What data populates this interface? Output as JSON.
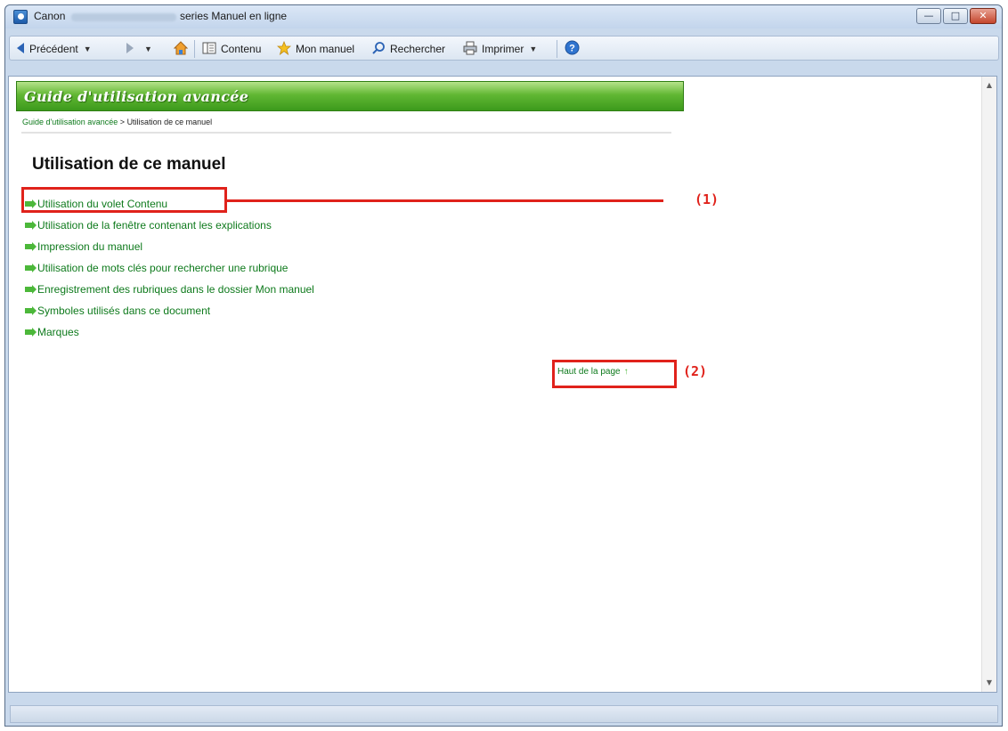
{
  "window": {
    "title_prefix": "Canon",
    "title_suffix": "series Manuel en ligne"
  },
  "titlebar_controls": {
    "minimize_icon": "minimize-icon",
    "maximize_icon": "maximize-icon",
    "close_icon": "close-icon"
  },
  "toolbar": {
    "back_label": "Précédent",
    "contents_label": "Contenu",
    "my_manual_label": "Mon manuel",
    "search_label": "Rechercher",
    "print_label": "Imprimer"
  },
  "page": {
    "banner_title": "Guide d'utilisation avancée",
    "breadcrumb_link": "Guide d'utilisation avancée",
    "breadcrumb_separator": " > ",
    "breadcrumb_current": "Utilisation de ce manuel",
    "title": "Utilisation de ce manuel",
    "links": [
      "Utilisation du volet Contenu",
      "Utilisation de la fenêtre contenant les explications",
      "Impression du manuel",
      "Utilisation de mots clés pour rechercher une rubrique",
      "Enregistrement des rubriques dans le dossier Mon manuel",
      "Symboles utilisés dans ce document",
      "Marques"
    ],
    "top_link": "Haut de la page",
    "top_arrow": "↑"
  },
  "annotations": {
    "callout1_label": "(1)",
    "callout2_label": "(2)",
    "color": "#e0221b"
  },
  "colors": {
    "link": "#0e7a1c",
    "banner": "#61b733"
  }
}
